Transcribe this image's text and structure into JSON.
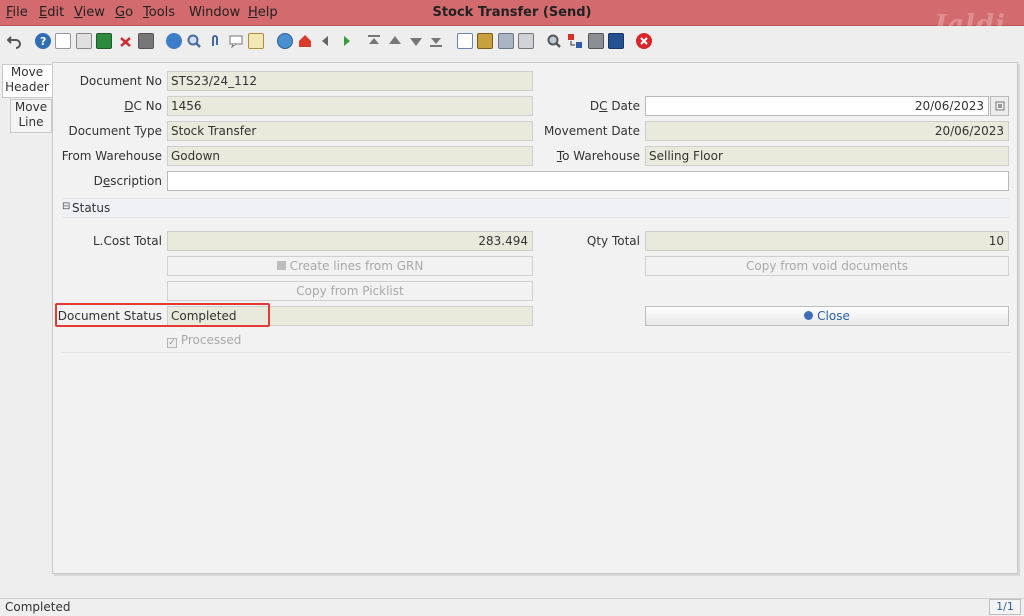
{
  "menu": [
    {
      "label": "File",
      "accel": "F"
    },
    {
      "label": "Edit",
      "accel": "E"
    },
    {
      "label": "View",
      "accel": "V"
    },
    {
      "label": "Go",
      "accel": "G"
    },
    {
      "label": "Tools",
      "accel": "T"
    },
    {
      "label": "Window",
      "accel": ""
    },
    {
      "label": "Help",
      "accel": "H"
    }
  ],
  "window_title": "Stock Transfer (Send)",
  "brand": "Jaldi",
  "toolbar_icons": [
    "undo-icon",
    "help-icon",
    "new-doc-icon",
    "copy-icon",
    "save-new-icon",
    "delete-icon",
    "save-icon",
    "refresh-icon",
    "find-icon",
    "attach-icon",
    "chat-icon",
    "history-icon",
    "home-icon",
    "home-window-icon",
    "back-icon",
    "forward-icon",
    "first-record-icon",
    "previous-record-icon",
    "next-record-icon",
    "last-record-icon",
    "report-icon",
    "archive-icon",
    "print-preview-icon",
    "print-icon",
    "zoom-across-icon",
    "workflow-icon",
    "process-icon",
    "product-info-icon",
    "exit-icon"
  ],
  "tabs": {
    "move_header": {
      "line1": "Move",
      "line2": "Header"
    },
    "move_line": {
      "line1": "Move",
      "line2": "Line"
    }
  },
  "form": {
    "document_no": {
      "label": "Document No",
      "value": "STS23/24_112"
    },
    "dc_no": {
      "label_u": "D",
      "label_rest": "C No",
      "value": "1456"
    },
    "dc_date": {
      "label_a": "D",
      "label_u": "C",
      "label_rest": " Date",
      "value": "20/06/2023"
    },
    "document_type": {
      "label": "Document Type",
      "value": "Stock Transfer"
    },
    "movement_date": {
      "label": "Movement Date",
      "value": "20/06/2023"
    },
    "from_warehouse": {
      "label": "From Warehouse",
      "value": "Godown"
    },
    "to_warehouse": {
      "label_u": "T",
      "label_rest": "o Warehouse",
      "value": "Selling Floor"
    },
    "description": {
      "label_a": "D",
      "label_u": "e",
      "label_rest": "scription",
      "value": ""
    }
  },
  "status_section": {
    "toggle": "⊟",
    "title": "Status",
    "lcost_total": {
      "label": "L.Cost Total",
      "value": "283.494"
    },
    "qty_total": {
      "label": "Qty Total",
      "value": "10"
    },
    "create_lines_label": "Create lines from GRN",
    "copy_void_label": "Copy from void documents",
    "copy_picklist_label": "Copy from Picklist",
    "document_status": {
      "label": "Document Status",
      "value": "Completed"
    },
    "close_label": "Close",
    "processed_label": "Processed",
    "processed_checked": true
  },
  "statusbar": {
    "message": "Completed",
    "pager": "1/1"
  },
  "colors": {
    "titlebar": "#d36a6e",
    "highlight": "#e53935",
    "link_blue": "#2b5ea7"
  }
}
